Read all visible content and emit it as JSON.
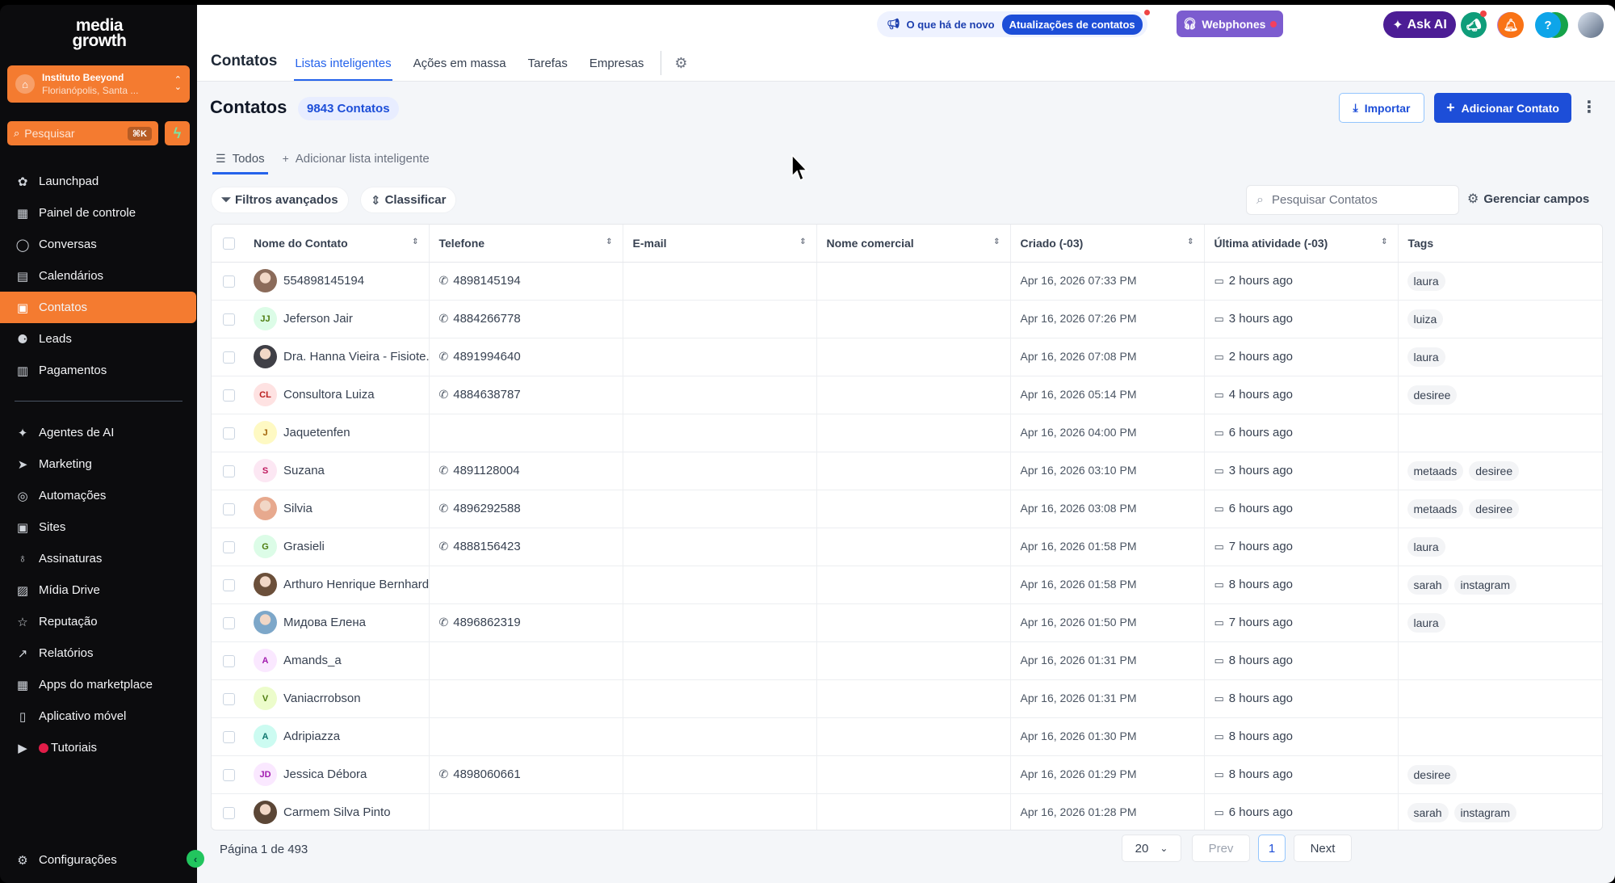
{
  "sidebar": {
    "logo_line1": "media",
    "logo_line2": "growth",
    "location_name": "Instituto Beeyond",
    "location_sub": "Florianópolis, Santa ...",
    "search_placeholder": "Pesquisar",
    "search_shortcut": "⌘K",
    "items_top": [
      {
        "label": "Launchpad",
        "icon": "rocket-icon",
        "glyph": "✿"
      },
      {
        "label": "Painel de controle",
        "icon": "dashboard-icon",
        "glyph": "▦"
      },
      {
        "label": "Conversas",
        "icon": "chat-icon",
        "glyph": "◯"
      },
      {
        "label": "Calendários",
        "icon": "calendar-icon",
        "glyph": "▤"
      },
      {
        "label": "Contatos",
        "icon": "contacts-icon",
        "glyph": "▣",
        "active": true
      },
      {
        "label": "Leads",
        "icon": "leads-icon",
        "glyph": "⚈"
      },
      {
        "label": "Pagamentos",
        "icon": "payments-icon",
        "glyph": "▥"
      }
    ],
    "items_bottom": [
      {
        "label": "Agentes de AI",
        "icon": "ai-agents-icon",
        "glyph": "✦"
      },
      {
        "label": "Marketing",
        "icon": "marketing-icon",
        "glyph": "➤"
      },
      {
        "label": "Automações",
        "icon": "automation-icon",
        "glyph": "◎"
      },
      {
        "label": "Sites",
        "icon": "sites-icon",
        "glyph": "▣"
      },
      {
        "label": "Assinaturas",
        "icon": "membership-icon",
        "glyph": "♁"
      },
      {
        "label": "Mídia Drive",
        "icon": "media-icon",
        "glyph": "▨"
      },
      {
        "label": "Reputação",
        "icon": "star-icon",
        "glyph": "☆"
      },
      {
        "label": "Relatórios",
        "icon": "reports-icon",
        "glyph": "↗"
      },
      {
        "label": "Apps do marketplace",
        "icon": "apps-icon",
        "glyph": "▦"
      },
      {
        "label": "Aplicativo móvel",
        "icon": "mobile-icon",
        "glyph": "▯"
      },
      {
        "label": "Tutoriais",
        "icon": "youtube-icon",
        "glyph": "▶"
      }
    ],
    "settings_label": "Configurações"
  },
  "topbar": {
    "news_label": "O que há de novo",
    "news_pill": "Atualizações de contatos",
    "webphones_label": "Webphones",
    "askai_label": "Ask AI"
  },
  "page_tabs": {
    "title": "Contatos",
    "tabs": [
      "Listas inteligentes",
      "Ações em massa",
      "Tarefas",
      "Empresas"
    ]
  },
  "header": {
    "title": "Contatos",
    "count": "9843 Contatos",
    "import_label": "Importar",
    "add_label": "Adicionar Contato"
  },
  "sub_tabs": {
    "all_label": "Todos",
    "add_list_label": "Adicionar lista inteligente"
  },
  "filters": {
    "advanced_label": "Filtros avançados",
    "sort_label": "Classificar",
    "search_placeholder": "Pesquisar Contatos",
    "manage_fields_label": "Gerenciar campos"
  },
  "table": {
    "columns": [
      "Nome do Contato",
      "Telefone",
      "E-mail",
      "Nome comercial",
      "Criado (-03)",
      "Última atividade (-03)",
      "Tags"
    ],
    "rows": [
      {
        "name": "554898145194",
        "initials": "",
        "avatar_bg": "#8b6b5a",
        "avatar_fg": "#fff",
        "photo": true,
        "phone": "4898145194",
        "created": "Apr 16, 2026 07:33 PM",
        "activity": "2 hours ago",
        "tags": [
          "laura"
        ]
      },
      {
        "name": "Jeferson Jair",
        "initials": "JJ",
        "avatar_bg": "#dcfce7",
        "avatar_fg": "#4d7c0f",
        "photo": false,
        "phone": "4884266778",
        "created": "Apr 16, 2026 07:26 PM",
        "activity": "3 hours ago",
        "tags": [
          "luiza"
        ]
      },
      {
        "name": "Dra. Hanna Vieira - Fisiote...",
        "initials": "",
        "avatar_bg": "#3f3f46",
        "avatar_fg": "#fff",
        "photo": true,
        "phone": "4891994640",
        "created": "Apr 16, 2026 07:08 PM",
        "activity": "2 hours ago",
        "tags": [
          "laura"
        ]
      },
      {
        "name": "Consultora Luiza",
        "initials": "CL",
        "avatar_bg": "#fee2e2",
        "avatar_fg": "#b91c1c",
        "photo": false,
        "phone": "4884638787",
        "created": "Apr 16, 2026 05:14 PM",
        "activity": "4 hours ago",
        "tags": [
          "desiree"
        ]
      },
      {
        "name": "Jaquetenfen",
        "initials": "J",
        "avatar_bg": "#fef9c3",
        "avatar_fg": "#a16207",
        "photo": false,
        "phone": "",
        "created": "Apr 16, 2026 04:00 PM",
        "activity": "6 hours ago",
        "tags": []
      },
      {
        "name": "Suzana",
        "initials": "S",
        "avatar_bg": "#fce7f3",
        "avatar_fg": "#be185d",
        "photo": false,
        "phone": "4891128004",
        "created": "Apr 16, 2026 03:10 PM",
        "activity": "3 hours ago",
        "tags": [
          "metaads",
          "desiree"
        ]
      },
      {
        "name": "Silvia",
        "initials": "",
        "avatar_bg": "#e7a98e",
        "avatar_fg": "#fff",
        "photo": true,
        "phone": "4896292588",
        "created": "Apr 16, 2026 03:08 PM",
        "activity": "6 hours ago",
        "tags": [
          "metaads",
          "desiree"
        ]
      },
      {
        "name": "Grasieli",
        "initials": "G",
        "avatar_bg": "#dcfce7",
        "avatar_fg": "#4d7c0f",
        "photo": false,
        "phone": "4888156423",
        "created": "Apr 16, 2026 01:58 PM",
        "activity": "7 hours ago",
        "tags": [
          "laura"
        ]
      },
      {
        "name": "Arthuro Henrique Bernhardt",
        "initials": "",
        "avatar_bg": "#6b4f3a",
        "avatar_fg": "#fff",
        "photo": true,
        "phone": "",
        "created": "Apr 16, 2026 01:58 PM",
        "activity": "8 hours ago",
        "tags": [
          "sarah",
          "instagram"
        ]
      },
      {
        "name": "Мидова Елена",
        "initials": "",
        "avatar_bg": "#7da7c9",
        "avatar_fg": "#fff",
        "photo": true,
        "phone": "4896862319",
        "created": "Apr 16, 2026 01:50 PM",
        "activity": "7 hours ago",
        "tags": [
          "laura"
        ]
      },
      {
        "name": "Amands_a",
        "initials": "A",
        "avatar_bg": "#fae8ff",
        "avatar_fg": "#a21caf",
        "photo": false,
        "phone": "",
        "created": "Apr 16, 2026 01:31 PM",
        "activity": "8 hours ago",
        "tags": []
      },
      {
        "name": "Vaniacrrobson",
        "initials": "V",
        "avatar_bg": "#ecfccb",
        "avatar_fg": "#4d7c0f",
        "photo": false,
        "phone": "",
        "created": "Apr 16, 2026 01:31 PM",
        "activity": "8 hours ago",
        "tags": []
      },
      {
        "name": "Adripiazza",
        "initials": "A",
        "avatar_bg": "#ccfbf1",
        "avatar_fg": "#0f766e",
        "photo": false,
        "phone": "",
        "created": "Apr 16, 2026 01:30 PM",
        "activity": "8 hours ago",
        "tags": []
      },
      {
        "name": "Jessica Débora",
        "initials": "JD",
        "avatar_bg": "#fae8ff",
        "avatar_fg": "#a21caf",
        "photo": false,
        "phone": "4898060661",
        "created": "Apr 16, 2026 01:29 PM",
        "activity": "8 hours ago",
        "tags": [
          "desiree"
        ]
      },
      {
        "name": "Carmem Silva Pinto",
        "initials": "",
        "avatar_bg": "#5b4636",
        "avatar_fg": "#fff",
        "photo": true,
        "phone": "",
        "created": "Apr 16, 2026 01:28 PM",
        "activity": "6 hours ago",
        "tags": [
          "sarah",
          "instagram"
        ]
      }
    ]
  },
  "pagination": {
    "page_info": "Página 1 de 493",
    "per_page": "20",
    "prev_label": "Prev",
    "current_page": "1",
    "next_label": "Next"
  },
  "colors": {
    "accent_orange": "#f47b30",
    "primary_blue": "#1d4ed8",
    "sidebar_bg": "#0c0c0e"
  }
}
